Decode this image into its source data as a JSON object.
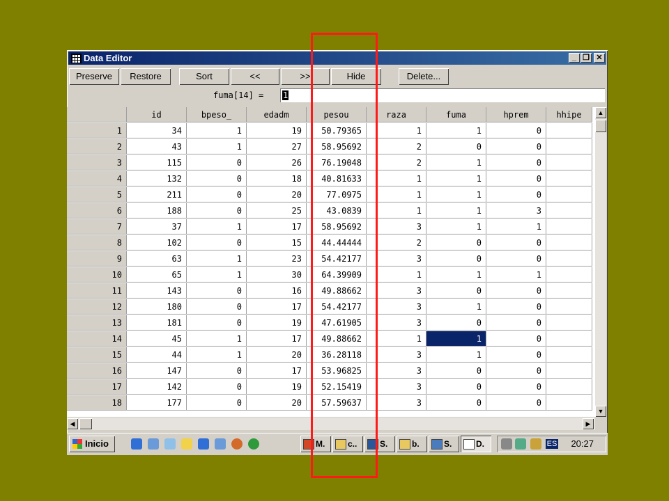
{
  "window": {
    "title": "Data Editor",
    "controls": [
      "_",
      "❐",
      "✕"
    ]
  },
  "toolbar": {
    "preserve": "Preserve",
    "restore": "Restore",
    "sort": "Sort",
    "prev": "<<",
    "next": ">>",
    "hide": "Hide",
    "delete": "Delete..."
  },
  "editbar": {
    "label": "fuma[14] =",
    "value": "1"
  },
  "grid": {
    "columns": [
      "id",
      "bpeso_",
      "edadm",
      "pesou",
      "raza",
      "fuma",
      "hprem",
      "hhipe"
    ],
    "rows": [
      {
        "n": "1",
        "id": "34",
        "bpeso_": "1",
        "edadm": "19",
        "pesou": "50.79365",
        "raza": "1",
        "fuma": "1",
        "hprem": "0"
      },
      {
        "n": "2",
        "id": "43",
        "bpeso_": "1",
        "edadm": "27",
        "pesou": "58.95692",
        "raza": "2",
        "fuma": "0",
        "hprem": "0"
      },
      {
        "n": "3",
        "id": "115",
        "bpeso_": "0",
        "edadm": "26",
        "pesou": "76.19048",
        "raza": "2",
        "fuma": "1",
        "hprem": "0"
      },
      {
        "n": "4",
        "id": "132",
        "bpeso_": "0",
        "edadm": "18",
        "pesou": "40.81633",
        "raza": "1",
        "fuma": "1",
        "hprem": "0"
      },
      {
        "n": "5",
        "id": "211",
        "bpeso_": "0",
        "edadm": "20",
        "pesou": "77.0975",
        "raza": "1",
        "fuma": "1",
        "hprem": "0"
      },
      {
        "n": "6",
        "id": "188",
        "bpeso_": "0",
        "edadm": "25",
        "pesou": "43.0839",
        "raza": "1",
        "fuma": "1",
        "hprem": "3"
      },
      {
        "n": "7",
        "id": "37",
        "bpeso_": "1",
        "edadm": "17",
        "pesou": "58.95692",
        "raza": "3",
        "fuma": "1",
        "hprem": "1"
      },
      {
        "n": "8",
        "id": "102",
        "bpeso_": "0",
        "edadm": "15",
        "pesou": "44.44444",
        "raza": "2",
        "fuma": "0",
        "hprem": "0"
      },
      {
        "n": "9",
        "id": "63",
        "bpeso_": "1",
        "edadm": "23",
        "pesou": "54.42177",
        "raza": "3",
        "fuma": "0",
        "hprem": "0"
      },
      {
        "n": "10",
        "id": "65",
        "bpeso_": "1",
        "edadm": "30",
        "pesou": "64.39909",
        "raza": "1",
        "fuma": "1",
        "hprem": "1"
      },
      {
        "n": "11",
        "id": "143",
        "bpeso_": "0",
        "edadm": "16",
        "pesou": "49.88662",
        "raza": "3",
        "fuma": "0",
        "hprem": "0"
      },
      {
        "n": "12",
        "id": "180",
        "bpeso_": "0",
        "edadm": "17",
        "pesou": "54.42177",
        "raza": "3",
        "fuma": "1",
        "hprem": "0"
      },
      {
        "n": "13",
        "id": "181",
        "bpeso_": "0",
        "edadm": "19",
        "pesou": "47.61905",
        "raza": "3",
        "fuma": "0",
        "hprem": "0"
      },
      {
        "n": "14",
        "id": "45",
        "bpeso_": "1",
        "edadm": "17",
        "pesou": "49.88662",
        "raza": "1",
        "fuma": "1",
        "hprem": "0"
      },
      {
        "n": "15",
        "id": "44",
        "bpeso_": "1",
        "edadm": "20",
        "pesou": "36.28118",
        "raza": "3",
        "fuma": "1",
        "hprem": "0"
      },
      {
        "n": "16",
        "id": "147",
        "bpeso_": "0",
        "edadm": "17",
        "pesou": "53.96825",
        "raza": "3",
        "fuma": "0",
        "hprem": "0"
      },
      {
        "n": "17",
        "id": "142",
        "bpeso_": "0",
        "edadm": "19",
        "pesou": "52.15419",
        "raza": "3",
        "fuma": "0",
        "hprem": "0"
      },
      {
        "n": "18",
        "id": "177",
        "bpeso_": "0",
        "edadm": "20",
        "pesou": "57.59637",
        "raza": "3",
        "fuma": "0",
        "hprem": "0"
      }
    ],
    "selected": {
      "row": 14,
      "column": "fuma"
    }
  },
  "taskbar": {
    "start": "Inicio",
    "tasks": [
      {
        "label": "M.",
        "icon": "powerpoint-icon",
        "color": "#d24726"
      },
      {
        "label": "c..",
        "icon": "folder-icon",
        "color": "#e8c860"
      },
      {
        "label": "S.",
        "icon": "word-icon",
        "color": "#2b579a"
      },
      {
        "label": "b.",
        "icon": "folder-icon",
        "color": "#e8c860"
      },
      {
        "label": "S.",
        "icon": "stata-icon",
        "color": "#4a7bbd"
      },
      {
        "label": "D.",
        "icon": "data-editor-icon",
        "color": "#ffffff"
      }
    ],
    "language": "ES",
    "clock": "20:27"
  },
  "colors": {
    "desktop": "#808000",
    "selection": "#0a246a",
    "highlight_box": "#ff1a1a"
  }
}
